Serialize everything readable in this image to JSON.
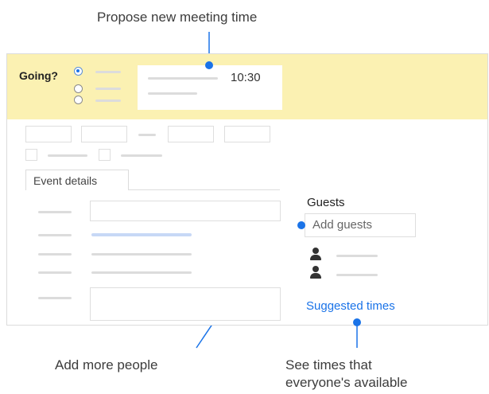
{
  "callouts": {
    "propose": "Propose new meeting time",
    "add_people": "Add more people",
    "see_times_line1": "See times that",
    "see_times_line2": "everyone's available"
  },
  "rsvp": {
    "label": "Going?",
    "time": "10:30"
  },
  "tabs": {
    "event_details": "Event details"
  },
  "guests": {
    "heading": "Guests",
    "placeholder": "Add guests",
    "suggested_times": "Suggested times"
  },
  "colors": {
    "highlight": "#fbf1b2",
    "accent": "#1a73e8",
    "link": "#1a73e8"
  }
}
